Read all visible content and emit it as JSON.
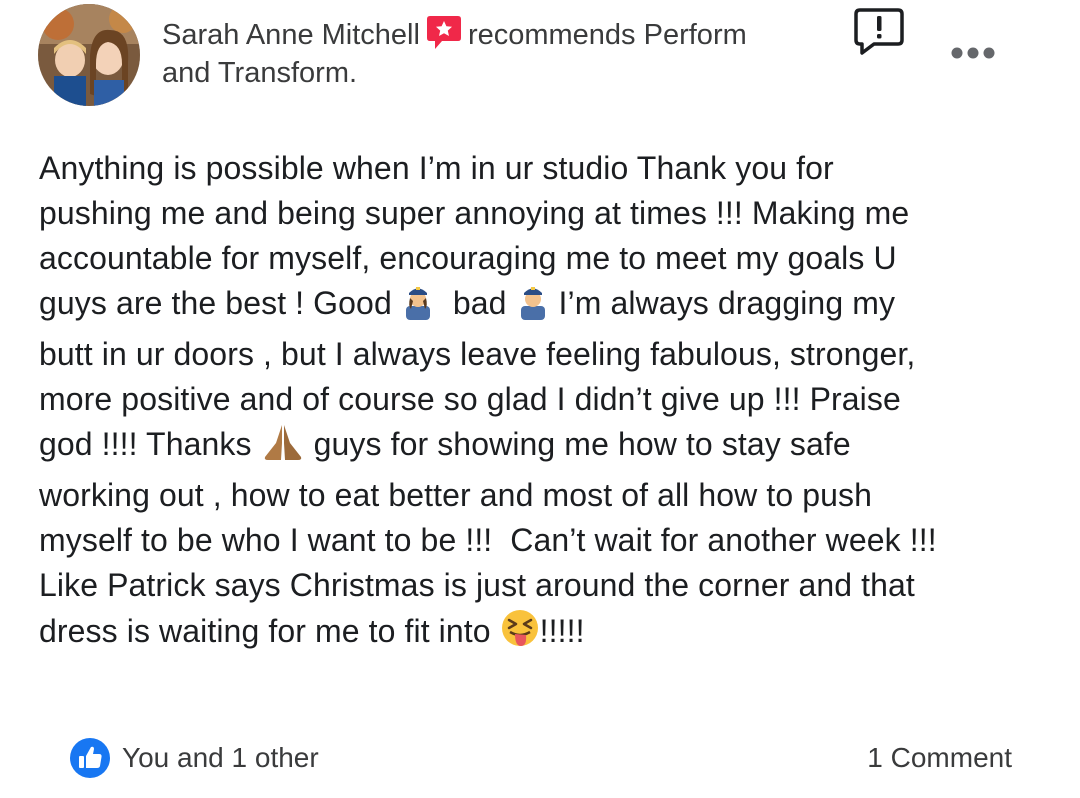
{
  "header": {
    "author": "Sarah Anne Mitchell",
    "action": "recommends",
    "page_line1": "Perform",
    "page_line2": "and Transform."
  },
  "icons": {
    "recommend": "recommend-badge-icon",
    "report": "report-flag-icon",
    "more": "more-options-icon",
    "like": "like-thumb-icon"
  },
  "post": {
    "lines": [
      "Anything is possible when I’m in ur studio Thank you for",
      "pushing me and being super annoying at times !!! Making me",
      "accountable for myself, encouraging me to meet my goals U",
      "guys are the best ! Good",
      "bad",
      "I’m always dragging my",
      "butt in ur doors , but I always leave feeling fabulous, stronger,",
      "more positive and of course so glad I didn’t give up !!! Praise",
      "god !!!! Thanks",
      "guys for showing me how to stay safe",
      "working out , how to eat better and most of all how to push",
      "myself to be who I want to be !!!  Can’t wait for another week !!!",
      "Like Patrick says Christmas is just around the corner and that",
      "dress is waiting for me to fit into",
      "!!!!!"
    ],
    "emojis": [
      "female-police-officer",
      "male-police-officer",
      "folded-hands",
      "squinting-tongue-face"
    ]
  },
  "footer": {
    "reactions": "You and 1 other",
    "comments": "1 Comment"
  },
  "colors": {
    "accent_blue": "#1877f2",
    "recommend_red": "#f02849",
    "text": "#1c1e21",
    "secondary_text": "#3a3b3c"
  }
}
